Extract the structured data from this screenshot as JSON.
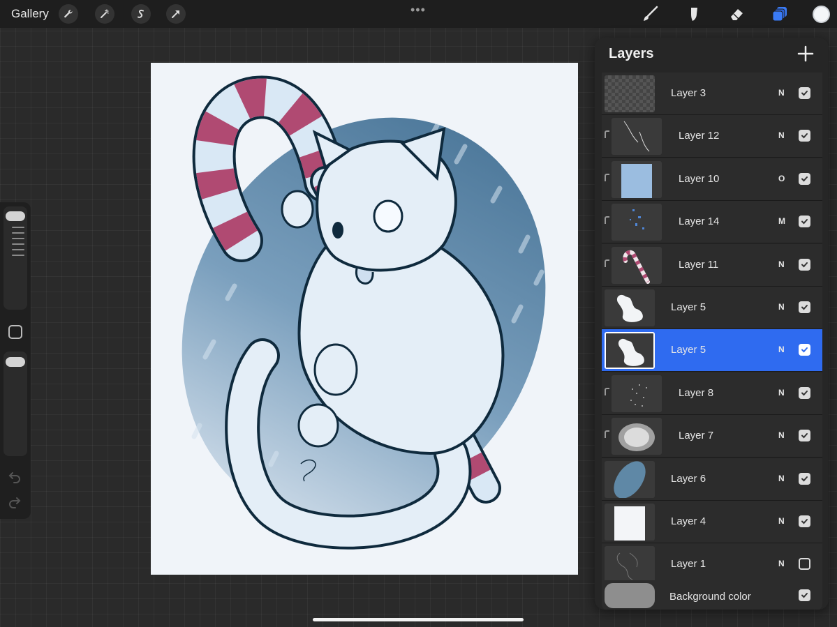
{
  "topbar": {
    "gallery_label": "Gallery",
    "left_tools": [
      "wrench-icon",
      "magic-wand-icon",
      "selection-icon",
      "transform-arrow-icon"
    ],
    "menu_dots": "•••",
    "right_tools": [
      "brush-icon",
      "smudge-icon",
      "eraser-icon",
      "layers-icon"
    ],
    "active_color": "#f4f6f8"
  },
  "sidebar": {
    "brush_size": 0.97,
    "opacity": 0.96
  },
  "layers_panel": {
    "title": "Layers",
    "layers": [
      {
        "name": "Layer 3",
        "blend": "N",
        "visible": true,
        "clipped": false,
        "selected": false,
        "thumb": "checker"
      },
      {
        "name": "Layer 12",
        "blend": "N",
        "visible": true,
        "clipped": true,
        "selected": false,
        "thumb": "lines"
      },
      {
        "name": "Layer 10",
        "blend": "O",
        "visible": true,
        "clipped": true,
        "selected": false,
        "thumb": "blue-fill"
      },
      {
        "name": "Layer 14",
        "blend": "M",
        "visible": true,
        "clipped": true,
        "selected": false,
        "thumb": "blue-specks"
      },
      {
        "name": "Layer 11",
        "blend": "N",
        "visible": true,
        "clipped": true,
        "selected": false,
        "thumb": "candy"
      },
      {
        "name": "Layer 5",
        "blend": "N",
        "visible": true,
        "clipped": false,
        "selected": false,
        "thumb": "cat-white"
      },
      {
        "name": "Layer 5",
        "blend": "N",
        "visible": true,
        "clipped": false,
        "selected": true,
        "thumb": "cat-white"
      },
      {
        "name": "Layer 8",
        "blend": "N",
        "visible": true,
        "clipped": true,
        "selected": false,
        "thumb": "speckle"
      },
      {
        "name": "Layer 7",
        "blend": "N",
        "visible": true,
        "clipped": true,
        "selected": false,
        "thumb": "blur"
      },
      {
        "name": "Layer 6",
        "blend": "N",
        "visible": true,
        "clipped": false,
        "selected": false,
        "thumb": "oval"
      },
      {
        "name": "Layer 4",
        "blend": "N",
        "visible": true,
        "clipped": false,
        "selected": false,
        "thumb": "white-page"
      },
      {
        "name": "Layer 1",
        "blend": "N",
        "visible": false,
        "clipped": false,
        "selected": false,
        "thumb": "sketch"
      }
    ],
    "background_label": "Background color",
    "background_color": "#8e8e8e",
    "background_visible": true
  },
  "colors": {
    "selected_row": "#2f6bf0",
    "oval": "#5f88a6",
    "candy_stripe": "#b04a72",
    "canvas_bg": "#f0f4f9"
  }
}
